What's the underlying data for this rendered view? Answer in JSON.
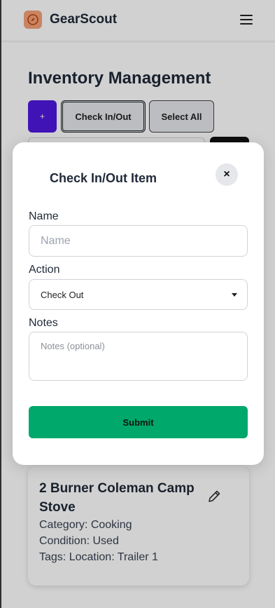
{
  "header": {
    "brand": "GearScout",
    "logo_icon": "compass-icon",
    "menu_icon": "hamburger-menu-icon"
  },
  "page": {
    "title": "Inventory Management",
    "toolbar": {
      "add_label": "+",
      "check_in_out_label": "Check In/Out",
      "select_all_label": "Select All"
    }
  },
  "item_card": {
    "title": "2 Burner Coleman Camp Stove",
    "category_label": "Category:",
    "category": "Cooking",
    "condition_label": "Condition:",
    "condition": "Used",
    "tags_label": "Tags:",
    "tags": "Location: Trailer 1",
    "edit_icon": "pencil-icon"
  },
  "modal": {
    "title": "Check In/Out Item",
    "close_label": "×",
    "name_label": "Name",
    "name_placeholder": "Name",
    "name_value": "",
    "action_label": "Action",
    "action_selected": "Check Out",
    "notes_label": "Notes",
    "notes_placeholder": "Notes (optional)",
    "submit_label": "Submit"
  },
  "colors": {
    "primary_purple": "#4f18e0",
    "submit_green": "#00a86b",
    "logo_orange": "#f4a37b"
  }
}
